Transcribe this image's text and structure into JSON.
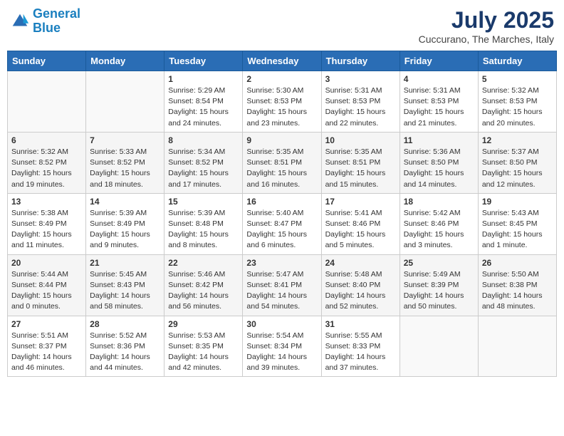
{
  "logo": {
    "line1": "General",
    "line2": "Blue"
  },
  "title": "July 2025",
  "subtitle": "Cuccurano, The Marches, Italy",
  "days_header": [
    "Sunday",
    "Monday",
    "Tuesday",
    "Wednesday",
    "Thursday",
    "Friday",
    "Saturday"
  ],
  "weeks": [
    [
      {
        "day": "",
        "info": ""
      },
      {
        "day": "",
        "info": ""
      },
      {
        "day": "1",
        "info": "Sunrise: 5:29 AM\nSunset: 8:54 PM\nDaylight: 15 hours\nand 24 minutes."
      },
      {
        "day": "2",
        "info": "Sunrise: 5:30 AM\nSunset: 8:53 PM\nDaylight: 15 hours\nand 23 minutes."
      },
      {
        "day": "3",
        "info": "Sunrise: 5:31 AM\nSunset: 8:53 PM\nDaylight: 15 hours\nand 22 minutes."
      },
      {
        "day": "4",
        "info": "Sunrise: 5:31 AM\nSunset: 8:53 PM\nDaylight: 15 hours\nand 21 minutes."
      },
      {
        "day": "5",
        "info": "Sunrise: 5:32 AM\nSunset: 8:53 PM\nDaylight: 15 hours\nand 20 minutes."
      }
    ],
    [
      {
        "day": "6",
        "info": "Sunrise: 5:32 AM\nSunset: 8:52 PM\nDaylight: 15 hours\nand 19 minutes."
      },
      {
        "day": "7",
        "info": "Sunrise: 5:33 AM\nSunset: 8:52 PM\nDaylight: 15 hours\nand 18 minutes."
      },
      {
        "day": "8",
        "info": "Sunrise: 5:34 AM\nSunset: 8:52 PM\nDaylight: 15 hours\nand 17 minutes."
      },
      {
        "day": "9",
        "info": "Sunrise: 5:35 AM\nSunset: 8:51 PM\nDaylight: 15 hours\nand 16 minutes."
      },
      {
        "day": "10",
        "info": "Sunrise: 5:35 AM\nSunset: 8:51 PM\nDaylight: 15 hours\nand 15 minutes."
      },
      {
        "day": "11",
        "info": "Sunrise: 5:36 AM\nSunset: 8:50 PM\nDaylight: 15 hours\nand 14 minutes."
      },
      {
        "day": "12",
        "info": "Sunrise: 5:37 AM\nSunset: 8:50 PM\nDaylight: 15 hours\nand 12 minutes."
      }
    ],
    [
      {
        "day": "13",
        "info": "Sunrise: 5:38 AM\nSunset: 8:49 PM\nDaylight: 15 hours\nand 11 minutes."
      },
      {
        "day": "14",
        "info": "Sunrise: 5:39 AM\nSunset: 8:49 PM\nDaylight: 15 hours\nand 9 minutes."
      },
      {
        "day": "15",
        "info": "Sunrise: 5:39 AM\nSunset: 8:48 PM\nDaylight: 15 hours\nand 8 minutes."
      },
      {
        "day": "16",
        "info": "Sunrise: 5:40 AM\nSunset: 8:47 PM\nDaylight: 15 hours\nand 6 minutes."
      },
      {
        "day": "17",
        "info": "Sunrise: 5:41 AM\nSunset: 8:46 PM\nDaylight: 15 hours\nand 5 minutes."
      },
      {
        "day": "18",
        "info": "Sunrise: 5:42 AM\nSunset: 8:46 PM\nDaylight: 15 hours\nand 3 minutes."
      },
      {
        "day": "19",
        "info": "Sunrise: 5:43 AM\nSunset: 8:45 PM\nDaylight: 15 hours\nand 1 minute."
      }
    ],
    [
      {
        "day": "20",
        "info": "Sunrise: 5:44 AM\nSunset: 8:44 PM\nDaylight: 15 hours\nand 0 minutes."
      },
      {
        "day": "21",
        "info": "Sunrise: 5:45 AM\nSunset: 8:43 PM\nDaylight: 14 hours\nand 58 minutes."
      },
      {
        "day": "22",
        "info": "Sunrise: 5:46 AM\nSunset: 8:42 PM\nDaylight: 14 hours\nand 56 minutes."
      },
      {
        "day": "23",
        "info": "Sunrise: 5:47 AM\nSunset: 8:41 PM\nDaylight: 14 hours\nand 54 minutes."
      },
      {
        "day": "24",
        "info": "Sunrise: 5:48 AM\nSunset: 8:40 PM\nDaylight: 14 hours\nand 52 minutes."
      },
      {
        "day": "25",
        "info": "Sunrise: 5:49 AM\nSunset: 8:39 PM\nDaylight: 14 hours\nand 50 minutes."
      },
      {
        "day": "26",
        "info": "Sunrise: 5:50 AM\nSunset: 8:38 PM\nDaylight: 14 hours\nand 48 minutes."
      }
    ],
    [
      {
        "day": "27",
        "info": "Sunrise: 5:51 AM\nSunset: 8:37 PM\nDaylight: 14 hours\nand 46 minutes."
      },
      {
        "day": "28",
        "info": "Sunrise: 5:52 AM\nSunset: 8:36 PM\nDaylight: 14 hours\nand 44 minutes."
      },
      {
        "day": "29",
        "info": "Sunrise: 5:53 AM\nSunset: 8:35 PM\nDaylight: 14 hours\nand 42 minutes."
      },
      {
        "day": "30",
        "info": "Sunrise: 5:54 AM\nSunset: 8:34 PM\nDaylight: 14 hours\nand 39 minutes."
      },
      {
        "day": "31",
        "info": "Sunrise: 5:55 AM\nSunset: 8:33 PM\nDaylight: 14 hours\nand 37 minutes."
      },
      {
        "day": "",
        "info": ""
      },
      {
        "day": "",
        "info": ""
      }
    ]
  ]
}
